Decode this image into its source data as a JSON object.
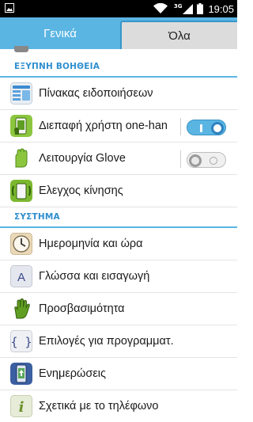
{
  "status_bar": {
    "network_type": "3G",
    "time": "19:05",
    "icons": [
      "image-notification-icon",
      "wifi-icon",
      "signal-icon",
      "battery-icon"
    ]
  },
  "tabs": [
    {
      "label": "Γενικά",
      "selected": false
    },
    {
      "label": "Όλα",
      "selected": true
    }
  ],
  "sections": [
    {
      "header": "ΕΞΥΠΝΗ ΒΟΗΘΕΙΑ",
      "items": [
        {
          "label": "Πίνακας ειδοποιήσεων",
          "icon": "notification-panel-icon"
        },
        {
          "label": "Διεπαφή χρήστη one-han",
          "icon": "one-hand-ui-icon",
          "toggle": "on"
        },
        {
          "label": "Λειτουργία Glove",
          "icon": "glove-icon",
          "toggle": "off"
        },
        {
          "label": "Ελεγχος κίνησης",
          "icon": "motion-control-icon"
        }
      ]
    },
    {
      "header": "ΣΥΣΤΗΜΑ",
      "items": [
        {
          "label": "Ημερομηνία και ώρα",
          "icon": "clock-icon"
        },
        {
          "label": "Γλώσσα και εισαγωγή",
          "icon": "language-icon"
        },
        {
          "label": "Προσβασιμότητα",
          "icon": "accessibility-hand-icon"
        },
        {
          "label": "Επιλογές για προγραμματ.",
          "icon": "developer-braces-icon"
        },
        {
          "label": "Ενημερώσεις",
          "icon": "updates-icon"
        },
        {
          "label": "Σχετικά με το τηλέφωνο",
          "icon": "info-icon"
        }
      ]
    }
  ],
  "colors": {
    "accent": "#5ab5e3",
    "header_text": "#2f8fcf",
    "toggle_on": "#2e82bf"
  }
}
